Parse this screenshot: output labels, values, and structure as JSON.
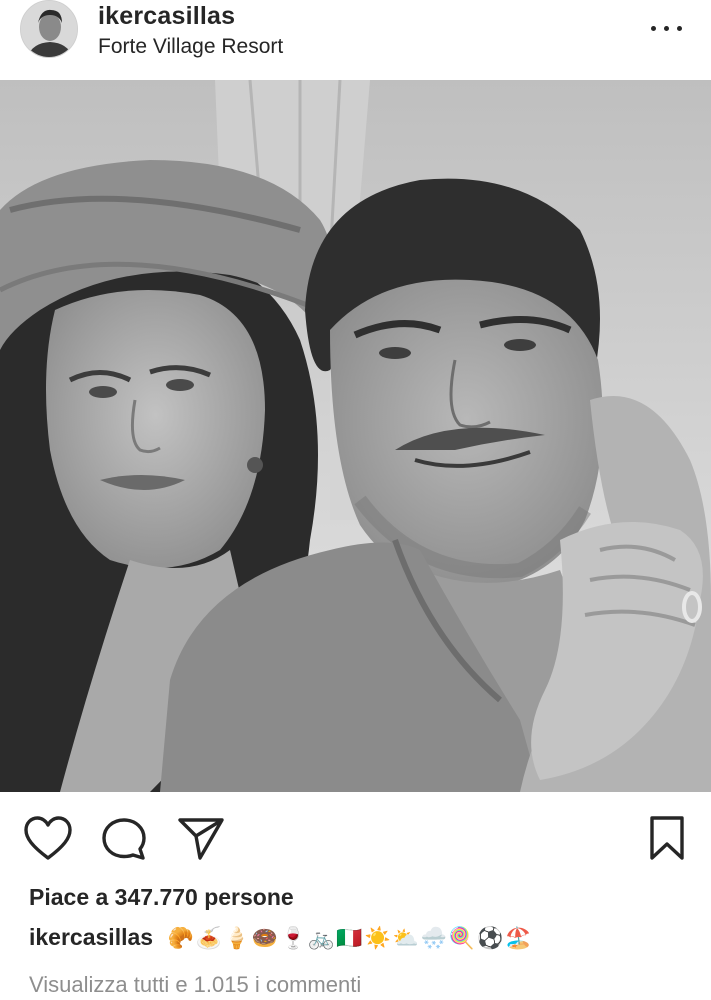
{
  "post": {
    "username": "ikercasillas",
    "location": "Forte Village Resort",
    "more_icon": "ellipsis-horizontal-icon",
    "photo_alt": "photo"
  },
  "actions": {
    "like_icon": "heart-icon",
    "comment_icon": "comment-bubble-icon",
    "share_icon": "paper-plane-icon",
    "save_icon": "bookmark-icon"
  },
  "likes_text": "Piace a 347.770 persone",
  "caption": {
    "username": "ikercasillas",
    "text": "🥐🍝🍦🍩🍷🚲🇮🇹☀️⛅🌨️🍭⚽🏖️"
  },
  "comments_link": "Visualizza tutti e 1.015 i commenti"
}
